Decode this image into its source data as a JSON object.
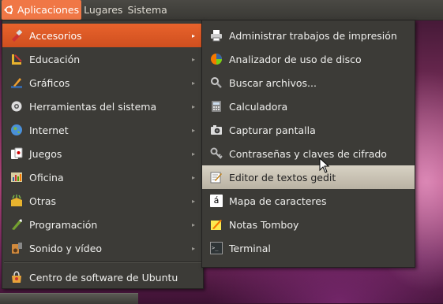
{
  "top_panel": {
    "menus": [
      "Aplicaciones",
      "Lugares",
      "Sistema"
    ]
  },
  "main_menu": {
    "items": [
      {
        "label": "Accesorios",
        "icon": "accessories-icon"
      },
      {
        "label": "Educación",
        "icon": "education-icon"
      },
      {
        "label": "Gráficos",
        "icon": "graphics-icon"
      },
      {
        "label": "Herramientas del sistema",
        "icon": "system-tools-icon"
      },
      {
        "label": "Internet",
        "icon": "internet-icon"
      },
      {
        "label": "Juegos",
        "icon": "games-icon"
      },
      {
        "label": "Oficina",
        "icon": "office-icon"
      },
      {
        "label": "Otras",
        "icon": "other-icon"
      },
      {
        "label": "Programación",
        "icon": "programming-icon"
      },
      {
        "label": "Sonido y vídeo",
        "icon": "sound-video-icon"
      }
    ],
    "footer_item": {
      "label": "Centro de software de Ubuntu",
      "icon": "software-center-icon"
    }
  },
  "submenu": {
    "items": [
      {
        "label": "Administrar trabajos de impresión",
        "icon": "printer-icon"
      },
      {
        "label": "Analizador de uso de disco",
        "icon": "disk-usage-icon"
      },
      {
        "label": "Buscar archivos...",
        "icon": "search-icon"
      },
      {
        "label": "Calculadora",
        "icon": "calculator-icon"
      },
      {
        "label": "Capturar pantalla",
        "icon": "camera-icon"
      },
      {
        "label": "Contraseñas y claves de cifrado",
        "icon": "keys-icon"
      },
      {
        "label": "Editor de textos gedit",
        "icon": "text-editor-icon"
      },
      {
        "label": "Mapa de caracteres",
        "icon": "charmap-icon"
      },
      {
        "label": "Notas Tomboy",
        "icon": "notes-icon"
      },
      {
        "label": "Terminal",
        "icon": "terminal-icon"
      }
    ]
  },
  "glyphs": {
    "arrow": "▸",
    "charmap": "á",
    "terminal": ">_"
  },
  "colors": {
    "highlight": "#e8632c",
    "menu_bg": "#3c3b37",
    "submenu_hover": "#c9c2b3"
  }
}
